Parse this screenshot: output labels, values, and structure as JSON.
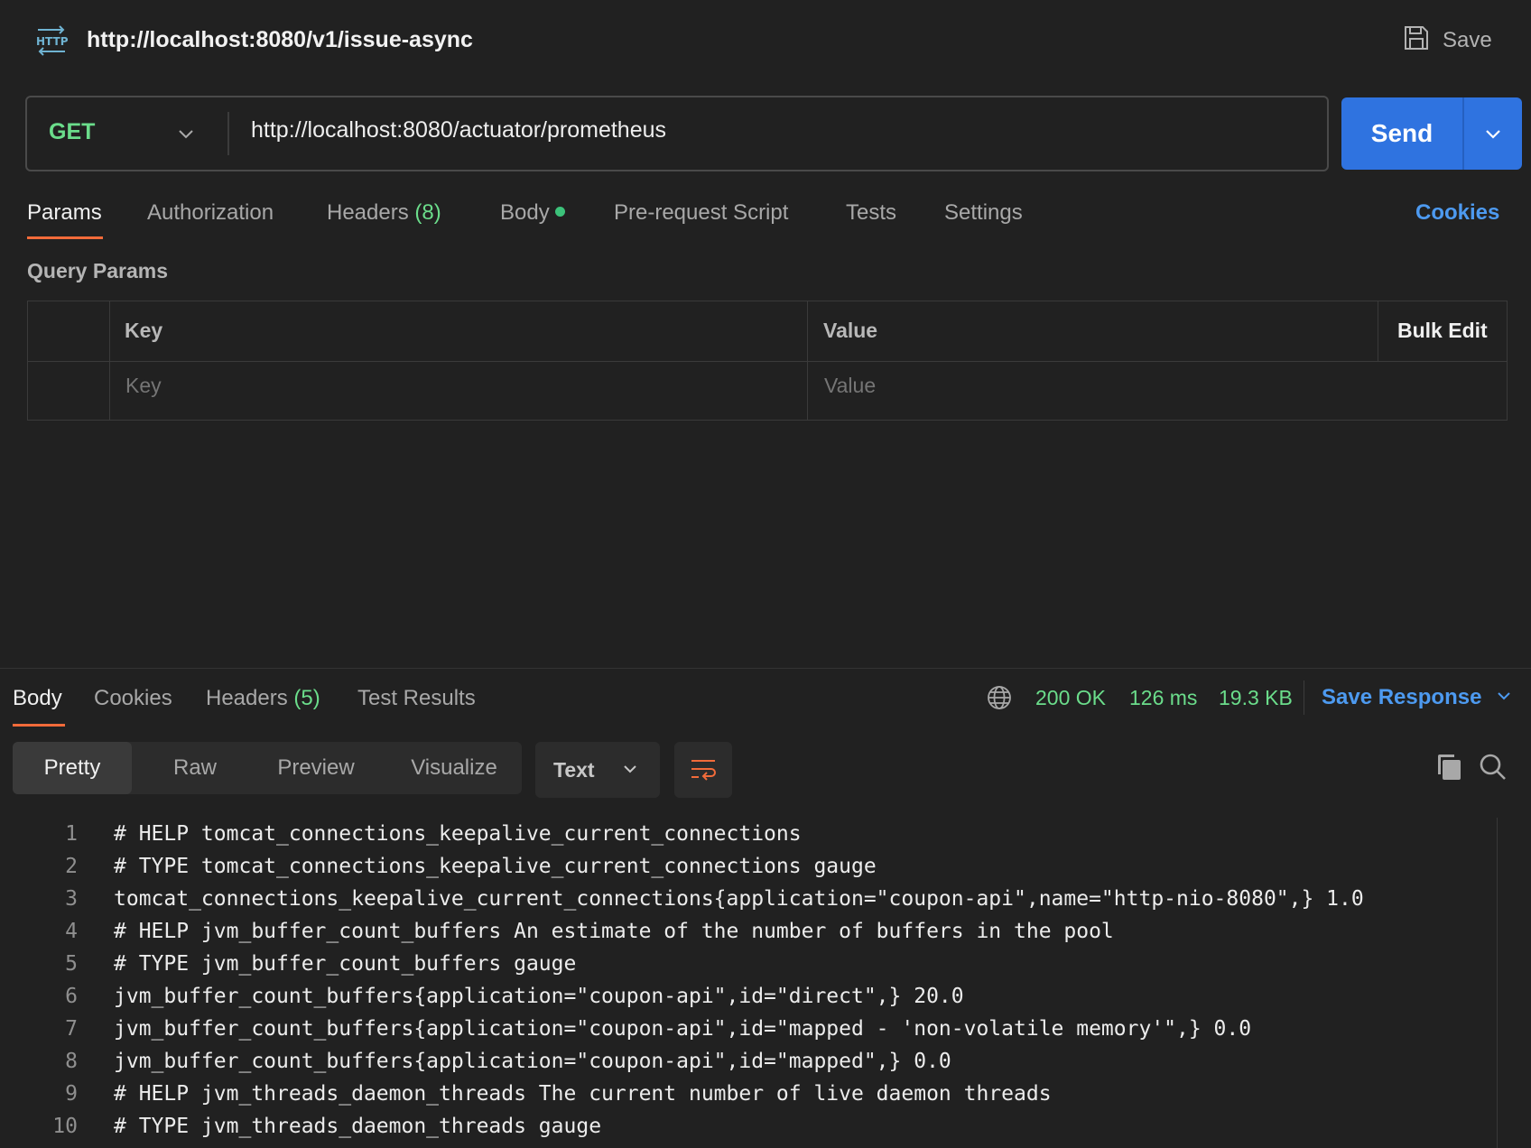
{
  "tab": {
    "icon": "http-icon",
    "title": "http://localhost:8080/v1/issue-async",
    "save_label": "Save"
  },
  "request": {
    "method": "GET",
    "url": "http://localhost:8080/actuator/prometheus",
    "send_label": "Send"
  },
  "request_tabs": {
    "params": "Params",
    "authorization": "Authorization",
    "headers": "Headers",
    "headers_count": "(8)",
    "body": "Body",
    "prerequest": "Pre-request Script",
    "tests": "Tests",
    "settings": "Settings",
    "cookies": "Cookies"
  },
  "query_params": {
    "title": "Query Params",
    "key_header": "Key",
    "value_header": "Value",
    "bulk_edit": "Bulk Edit",
    "key_placeholder": "Key",
    "value_placeholder": "Value"
  },
  "response": {
    "tabs": {
      "body": "Body",
      "cookies": "Cookies",
      "headers": "Headers",
      "headers_count": "(5)",
      "test_results": "Test Results"
    },
    "status": "200 OK",
    "time": "126 ms",
    "size": "19.3 KB",
    "save_response": "Save Response",
    "views": {
      "pretty": "Pretty",
      "raw": "Raw",
      "preview": "Preview",
      "visualize": "Visualize"
    },
    "format": "Text",
    "lines": [
      {
        "n": "1",
        "text": "# HELP tomcat_connections_keepalive_current_connections"
      },
      {
        "n": "2",
        "text": "# TYPE tomcat_connections_keepalive_current_connections gauge"
      },
      {
        "n": "3",
        "text": "tomcat_connections_keepalive_current_connections{application=\"coupon-api\",name=\"http-nio-8080\",} 1.0"
      },
      {
        "n": "4",
        "text": "# HELP jvm_buffer_count_buffers An estimate of the number of buffers in the pool"
      },
      {
        "n": "5",
        "text": "# TYPE jvm_buffer_count_buffers gauge"
      },
      {
        "n": "6",
        "text": "jvm_buffer_count_buffers{application=\"coupon-api\",id=\"direct\",} 20.0"
      },
      {
        "n": "7",
        "text": "jvm_buffer_count_buffers{application=\"coupon-api\",id=\"mapped - 'non-volatile memory'\",} 0.0"
      },
      {
        "n": "8",
        "text": "jvm_buffer_count_buffers{application=\"coupon-api\",id=\"mapped\",} 0.0"
      },
      {
        "n": "9",
        "text": "# HELP jvm_threads_daemon_threads The current number of live daemon threads"
      },
      {
        "n": "10",
        "text": "# TYPE jvm_threads_daemon_threads gauge"
      }
    ]
  },
  "colors": {
    "background": "#212121",
    "accent_orange": "#f26b3a",
    "primary_blue": "#2f73e0",
    "link_blue": "#4d9af0",
    "success_green": "#6bdd8b"
  }
}
